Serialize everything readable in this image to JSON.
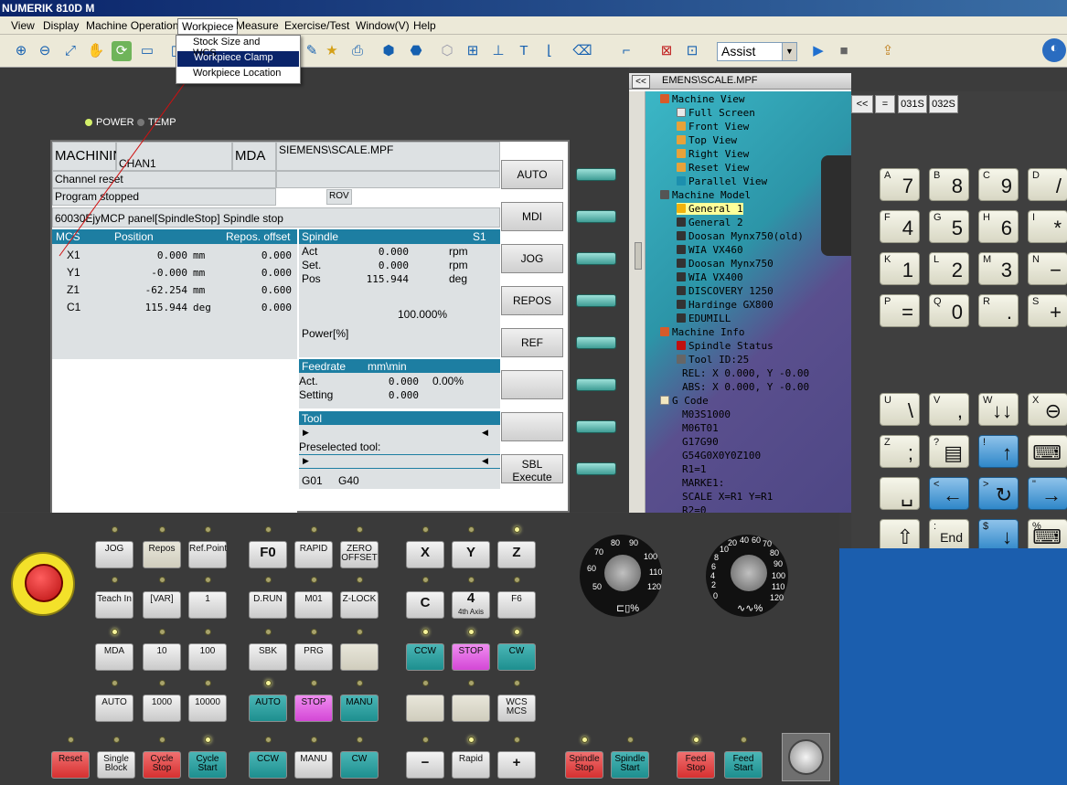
{
  "app": {
    "title": "NUMERIK 810D M"
  },
  "menu": {
    "items": [
      "View",
      "Display",
      "Machine Operation",
      "Workpiece",
      "Measure",
      "Exercise/Test",
      "Window(V)",
      "Help"
    ],
    "workpiece_dropdown": [
      "Stock Size and WCS",
      "Workpiece Clamp",
      "Workpiece Location"
    ]
  },
  "toolbar": {
    "mode_select": "Assist"
  },
  "indicators": {
    "power": "POWER",
    "temp": "TEMP"
  },
  "screen": {
    "mode": "MACHINING",
    "channel": "CHAN1",
    "op_mode": "MDA",
    "program": "SIEMENS\\SCALE.MPF",
    "channel_status": "Channel reset",
    "program_status": "Program stopped",
    "rov": "ROV",
    "alarm": "60030EjyMCP panel[SpindleStop] Spindle stop",
    "axes_header": {
      "mcs": "MCS",
      "position": "Position",
      "repos": "Repos. offset"
    },
    "axes": [
      {
        "name": "X1",
        "pos": "0.000",
        "unit": "mm",
        "offset": "0.000"
      },
      {
        "name": "Y1",
        "pos": "-0.000",
        "unit": "mm",
        "offset": "0.000"
      },
      {
        "name": "Z1",
        "pos": "-62.254",
        "unit": "mm",
        "offset": "0.600"
      },
      {
        "name": "C1",
        "pos": "115.944",
        "unit": "deg",
        "offset": "0.000"
      }
    ],
    "spindle": {
      "title": "Spindle",
      "id": "S1",
      "rows": [
        {
          "label": "Act",
          "value": "0.000",
          "unit": "rpm"
        },
        {
          "label": "Set.",
          "value": "0.000",
          "unit": "rpm"
        },
        {
          "label": "Pos",
          "value": "115.944",
          "unit": "deg"
        }
      ],
      "override": "100.000%",
      "power": "Power[%]"
    },
    "feedrate": {
      "title": "Feedrate",
      "unit": "mm\\min",
      "act_label": "Act.",
      "act": "0.000",
      "act_pct": "0.00%",
      "setting_label": "Setting",
      "setting": "0.000"
    },
    "tool": {
      "title": "Tool",
      "preselected": "Preselected tool:"
    },
    "gcodes": {
      "g1": "G01",
      "g2": "G40"
    },
    "softkeys": [
      "AUTO",
      "MDI",
      "JOG",
      "REPOS",
      "REF",
      "",
      "",
      "SBL Execute"
    ]
  },
  "sim": {
    "title": "EMENS\\SCALE.MPF",
    "tree": [
      "Machine View",
      "Full Screen",
      "Front View",
      "Top View",
      "Right View",
      "Reset View",
      "Parallel View",
      "Machine Model",
      "General 1",
      "General 2",
      "Doosan Mynx750(old)",
      "WIA VX460",
      "Doosan Mynx750",
      "WIA VX400",
      "DISCOVERY 1250",
      "Hardinge GX800",
      "EDUMILL",
      "Machine Info",
      "Spindle Status",
      "Tool ID:25",
      "REL: X   0.000, Y  -0.00",
      "ABS: X   0.000, Y  -0.00",
      "G Code",
      "M03S1000",
      "M06T01",
      "G17G90",
      "G54G0X0Y0Z100",
      "R1=1",
      "MARKE1:",
      "SCALE X=R1 Y=R1",
      "R2=0"
    ]
  },
  "keypad": {
    "tabs": [
      "<<",
      "=",
      "031S",
      "032S"
    ],
    "keys": [
      {
        "sup": "A",
        "main": "7"
      },
      {
        "sup": "B",
        "main": "8"
      },
      {
        "sup": "C",
        "main": "9"
      },
      {
        "sup": "D",
        "main": "/"
      },
      {
        "sup": "F",
        "main": "4"
      },
      {
        "sup": "G",
        "main": "5"
      },
      {
        "sup": "H",
        "main": "6"
      },
      {
        "sup": "I",
        "main": "*"
      },
      {
        "sup": "K",
        "main": "1"
      },
      {
        "sup": "L",
        "main": "2"
      },
      {
        "sup": "M",
        "main": "3"
      },
      {
        "sup": "N",
        "main": "−"
      },
      {
        "sup": "P",
        "main": "="
      },
      {
        "sup": "Q",
        "main": "0"
      },
      {
        "sup": "R",
        "main": "."
      },
      {
        "sup": "S",
        "main": "+"
      },
      {
        "sup": "U",
        "main": "\\"
      },
      {
        "sup": "V",
        "main": ","
      },
      {
        "sup": "W",
        "main": "↓↓"
      },
      {
        "sup": "X",
        "main": "⊖"
      },
      {
        "sup": "Z",
        "main": ";"
      },
      {
        "sup": "?",
        "main": "▤"
      },
      {
        "sup": "!",
        "main": "↑"
      },
      {
        "sup": "",
        "main": "⌨"
      },
      {
        "sup": "",
        "main": "␣"
      },
      {
        "sup": "<",
        "main": "←"
      },
      {
        "sup": ">",
        "main": "↻"
      },
      {
        "sup": "\"",
        "main": "→"
      },
      {
        "sup": "",
        "main": "⇧"
      },
      {
        "sup": ":",
        "main": "End"
      },
      {
        "sup": "$",
        "main": "↓"
      },
      {
        "sup": "%",
        "main": "⌨"
      }
    ]
  },
  "mcp": {
    "keys": {
      "jog": "JOG",
      "repos": "Repos",
      "refpoint": "Ref.Point",
      "teachin": "Teach In",
      "var": "[VAR]",
      "one": "1",
      "mda": "MDA",
      "ten": "10",
      "hundred": "100",
      "auto": "AUTO",
      "thousand": "1000",
      "tenthousand": "10000",
      "f0": "F0",
      "rapid": "RAPID",
      "zero_offset": "ZERO OFFSET",
      "drun": "D.RUN",
      "m01": "M01",
      "zlock": "Z-LOCK",
      "sbk": "SBK",
      "prg": "PRG",
      "auto2": "AUTO",
      "stop": "STOP",
      "manu": "MANU",
      "x": "X",
      "y": "Y",
      "z": "Z",
      "c": "C",
      "axis4": "4",
      "axis4_sub": "4th Axis",
      "f6": "F6",
      "ccw": "CCW",
      "stop2": "STOP",
      "cw": "CW",
      "wcs_mcs": "WCS MCS",
      "reset": "Reset",
      "single_block": "Single Block",
      "cycle_stop": "Cycle Stop",
      "cycle_start": "Cycle Start",
      "ccw2": "CCW",
      "manu2": "MANU",
      "cw2": "CW",
      "minus": "−",
      "rapid2": "Rapid",
      "plus": "+",
      "spindle_stop": "Spindle Stop",
      "spindle_start": "Spindle Start",
      "feed_stop": "Feed Stop",
      "feed_start": "Feed Start"
    },
    "spindle_dial": {
      "ticks": [
        "50",
        "60",
        "70",
        "80",
        "90",
        "100",
        "110",
        "120"
      ],
      "label": "%"
    },
    "feed_dial": {
      "ticks": [
        "0",
        "2",
        "4",
        "6",
        "8",
        "10",
        "20",
        "40",
        "60",
        "70",
        "80",
        "90",
        "100",
        "110",
        "120"
      ],
      "label": "%"
    }
  }
}
